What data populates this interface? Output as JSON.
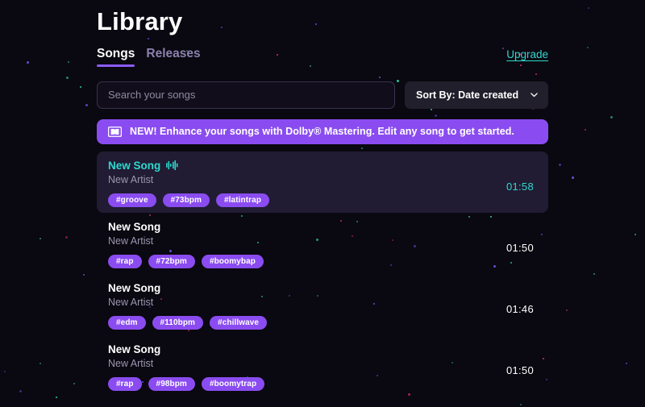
{
  "header": {
    "title": "Library",
    "upgrade_label": "Upgrade",
    "tabs": [
      {
        "label": "Songs",
        "active": true
      },
      {
        "label": "Releases",
        "active": false
      }
    ]
  },
  "controls": {
    "search": {
      "placeholder": "Search your songs",
      "value": "",
      "icon": "search-icon"
    },
    "sort": {
      "label": "Sort By: Date created",
      "icon": "chevron-down-icon",
      "options": [
        "Date created"
      ]
    }
  },
  "banner": {
    "icon": "dolby-icon",
    "text": "NEW! Enhance your songs with Dolby® Mastering. Edit any song to get started."
  },
  "songs": [
    {
      "title": "New Song",
      "artist": "New Artist",
      "duration": "01:58",
      "tags": [
        "#groove",
        "#73bpm",
        "#latintrap"
      ],
      "active": true,
      "status_icon": "audio-wave-icon"
    },
    {
      "title": "New Song",
      "artist": "New Artist",
      "duration": "01:50",
      "tags": [
        "#rap",
        "#72bpm",
        "#boomybap"
      ],
      "active": false,
      "status_icon": ""
    },
    {
      "title": "New Song",
      "artist": "New Artist",
      "duration": "01:46",
      "tags": [
        "#edm",
        "#110bpm",
        "#chillwave"
      ],
      "active": false,
      "status_icon": ""
    },
    {
      "title": "New Song",
      "artist": "New Artist",
      "duration": "01:50",
      "tags": [
        "#rap",
        "#98bpm",
        "#boomytrap"
      ],
      "active": false,
      "status_icon": ""
    }
  ],
  "colors": {
    "background": "#0a0810",
    "accent_purple": "#8a4cf0",
    "tab_underline": "#8a5cf6",
    "accent_teal": "#2fd8d0",
    "active_row_bg": "#211c33",
    "muted_text": "#9c96b0",
    "sort_bg": "#211f2b",
    "particle_pink": "#e0326a",
    "particle_teal": "#2fd8a8",
    "particle_purple": "#6a5cf0"
  }
}
